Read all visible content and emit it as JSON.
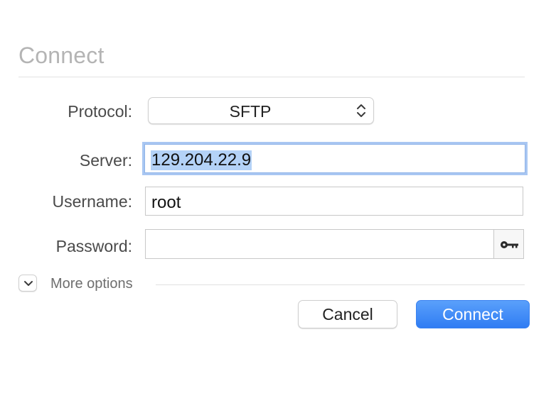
{
  "dialog": {
    "title": "Connect"
  },
  "form": {
    "protocol_label": "Protocol:",
    "protocol_value": "SFTP",
    "server_label": "Server:",
    "server_value": "129.204.22.9",
    "username_label": "Username:",
    "username_value": "root",
    "password_label": "Password:",
    "password_value": ""
  },
  "options": {
    "more_label": "More options"
  },
  "buttons": {
    "cancel_label": "Cancel",
    "connect_label": "Connect"
  },
  "colors": {
    "accent": "#2f7cf3",
    "selection": "#b4d2f7",
    "focus_ring": "#a9c7f2"
  },
  "icons": {
    "protocol_popup": "up-down-chevron-icon",
    "password_button": "key-icon",
    "more_options_toggle": "chevron-down-icon"
  }
}
